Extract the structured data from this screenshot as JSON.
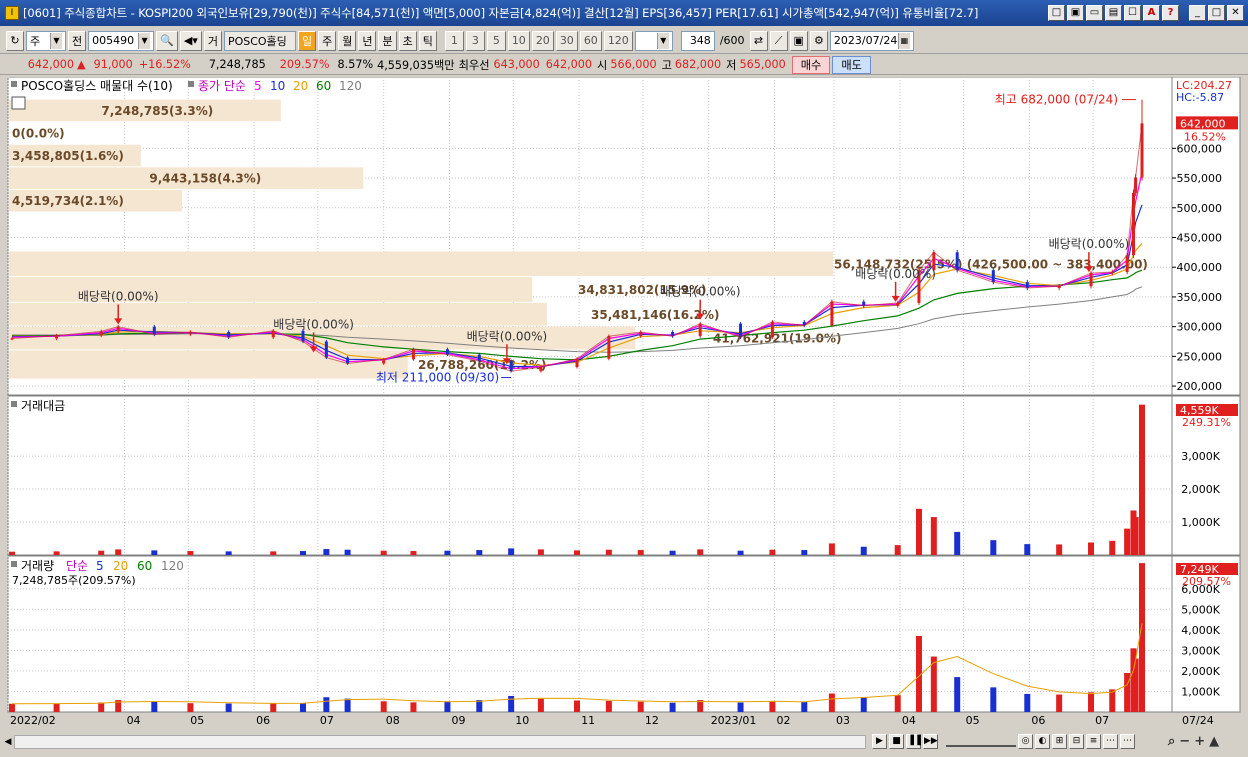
{
  "window": {
    "title": "[0601] 주식종합차트 - KOSPI200 외국인보유[29,790(천)] 주식수[84,571(천)] 액면[5,000] 자본금[4,824(억)] 결산[12월] EPS[36,457] PER[17.61] 시가총액[542,947(억)] 유통비율[72.7]",
    "icon": "app-icon",
    "buttons": [
      "□",
      "▣",
      "▭",
      "▤",
      "☐",
      "A",
      "?",
      "_",
      "□",
      "✕"
    ]
  },
  "toolbar": {
    "type_label": "주",
    "prev_label": "전",
    "code": "005490",
    "name_mode": "거",
    "stock_name": "POSCO홀딩",
    "periods": [
      "일",
      "주",
      "월",
      "년",
      "분",
      "초",
      "틱"
    ],
    "selected_period": "일",
    "intervals": [
      "1",
      "3",
      "5",
      "10",
      "20",
      "30",
      "60",
      "120"
    ],
    "count": "348",
    "count_max": "/600",
    "date": "2023/07/24"
  },
  "quote": {
    "price": "642,000",
    "change": "91,000",
    "change_pct": "+16.52%",
    "volume": "7,248,785",
    "volume_ratio": "209.57%",
    "turnover": "8.57%",
    "amount": "4,559,035백만",
    "best_ask_label": "최우선",
    "best_ask": "643,000",
    "best_bid": "642,000",
    "open_label": "시",
    "open": "566,000",
    "high_label": "고",
    "high": "682,000",
    "low_label": "저",
    "low": "565,000",
    "buy_label": "매수",
    "sell_label": "매도",
    "colors": {
      "up": "#e0201e",
      "down": "#1a2fd0"
    }
  },
  "chart_data": [
    {
      "type": "line",
      "panel": "price",
      "legend": {
        "title": "POSCO홀딩스 매물대 수(10)",
        "ma_label": "종가 단순",
        "ma_periods": [
          "5",
          "10",
          "20",
          "60",
          "120"
        ]
      },
      "x_ticks": [
        "2022/02",
        "04",
        "05",
        "06",
        "07",
        "08",
        "09",
        "10",
        "11",
        "12",
        "2023/01",
        "02",
        "03",
        "04",
        "05",
        "06",
        "07"
      ],
      "x_axis_end_label": "07/24",
      "y_ticks": [
        200000,
        250000,
        300000,
        350000,
        400000,
        450000,
        500000,
        550000,
        600000
      ],
      "y_tick_labels": [
        "200,000",
        "250,000",
        "300,000",
        "350,000",
        "400,000",
        "450,000",
        "500,000",
        "550,000",
        "600,000"
      ],
      "ylim": [
        185000,
        720000
      ],
      "overlay_labels": [
        "LC:204.27",
        "HC:-5.87"
      ],
      "last_value": "642,000",
      "last_pct": "16.52%",
      "volume_profile": [
        {
          "label": "7,248,785(3.3%)",
          "low": 644000,
          "high": 682000,
          "share": 0.33
        },
        {
          "label": "0(0.0%)",
          "low": 606000,
          "high": 644000,
          "share": 0.0
        },
        {
          "label": "3,458,805(1.6%)",
          "low": 568000,
          "high": 606000,
          "share": 0.16
        },
        {
          "label": "9,443,158(4.3%)",
          "low": 530000,
          "high": 568000,
          "share": 0.43
        },
        {
          "label": "4,519,734(2.1%)",
          "low": 492000,
          "high": 530000,
          "share": 0.21
        },
        {
          "label": "56,148,732(25.5%) (426,500.00 ~ 383,400.00)",
          "low": 383400,
          "high": 426500,
          "share": 1.0
        },
        {
          "label": "34,831,802(15.9%)",
          "low": 340000,
          "high": 383400,
          "share": 0.635
        },
        {
          "label": "35,481,146(16.2%)",
          "low": 300000,
          "high": 340000,
          "share": 0.653
        },
        {
          "label": "41,762,921(19.0%)",
          "low": 260000,
          "high": 300000,
          "share": 0.76
        },
        {
          "label": "26,788,260(12.2%)",
          "low": 211000,
          "high": 260000,
          "share": 0.484
        }
      ],
      "annotations": [
        {
          "label": "배당락(0.00%)",
          "date": "2022/03/29",
          "price": 297000
        },
        {
          "label": "배당락(0.00%)",
          "date": "2022/06/29",
          "price": 250000
        },
        {
          "label": "배당락(0.00%)",
          "date": "2022/09/28",
          "price": 230000
        },
        {
          "label": "배당락(0.00%)",
          "date": "2022/12/28",
          "price": 305000
        },
        {
          "label": "배당락(0.00%)",
          "date": "2023/03/30",
          "price": 335000
        },
        {
          "label": "배당락(0.00%)",
          "date": "2023/06/29",
          "price": 385000
        }
      ],
      "high_label": "최고 682,000 (07/24)",
      "low_label": "최저 211,000 (09/30)",
      "series": [
        {
          "name": "종가",
          "x": [
            "2022/02/07",
            "2022/02/28",
            "2022/03/21",
            "2022/03/29",
            "2022/04/15",
            "2022/05/02",
            "2022/05/20",
            "2022/06/10",
            "2022/06/24",
            "2022/07/05",
            "2022/07/15",
            "2022/08/01",
            "2022/08/15",
            "2022/08/31",
            "2022/09/15",
            "2022/09/30",
            "2022/10/14",
            "2022/10/31",
            "2022/11/15",
            "2022/11/30",
            "2022/12/15",
            "2022/12/28",
            "2023/01/16",
            "2023/01/31",
            "2023/02/15",
            "2023/02/28",
            "2023/03/15",
            "2023/03/31",
            "2023/04/10",
            "2023/04/17",
            "2023/04/28",
            "2023/05/15",
            "2023/05/31",
            "2023/06/15",
            "2023/06/30",
            "2023/07/10",
            "2023/07/17",
            "2023/07/20",
            "2023/07/21",
            "2023/07/24"
          ],
          "values": [
            280000,
            285000,
            292000,
            300000,
            287000,
            291000,
            282000,
            293000,
            275000,
            248000,
            238000,
            245000,
            262000,
            253000,
            242000,
            225000,
            232000,
            246000,
            284000,
            291000,
            284000,
            305000,
            282000,
            308000,
            302000,
            342000,
            335000,
            340000,
            395000,
            425000,
            395000,
            375000,
            365000,
            368000,
            390000,
            392000,
            420000,
            525000,
            551000,
            642000
          ]
        },
        {
          "name": "5",
          "values": [
            282000,
            284000,
            290000,
            297000,
            289000,
            290000,
            284000,
            291000,
            278000,
            253000,
            241000,
            244000,
            259000,
            255000,
            244000,
            229000,
            233000,
            244000,
            280000,
            289000,
            285000,
            302000,
            285000,
            305000,
            303000,
            338000,
            336000,
            338000,
            385000,
            415000,
            398000,
            378000,
            367000,
            368000,
            387000,
            391000,
            412000,
            490000,
            510000,
            560000
          ]
        },
        {
          "name": "10",
          "values": [
            283000,
            284000,
            288000,
            294000,
            291000,
            290000,
            286000,
            289000,
            281000,
            260000,
            245000,
            244000,
            255000,
            256000,
            247000,
            233000,
            233000,
            242000,
            274000,
            287000,
            286000,
            298000,
            288000,
            302000,
            303000,
            332000,
            336000,
            337000,
            372000,
            405000,
            400000,
            382000,
            369000,
            368000,
            383000,
            390000,
            404000,
            455000,
            475000,
            505000
          ]
        },
        {
          "name": "20",
          "values": [
            284000,
            284000,
            287000,
            291000,
            292000,
            290000,
            288000,
            288000,
            284000,
            268000,
            252000,
            246000,
            251000,
            255000,
            250000,
            239000,
            235000,
            240000,
            264000,
            283000,
            286000,
            293000,
            290000,
            298000,
            302000,
            322000,
            332000,
            336000,
            358000,
            388000,
            397000,
            386000,
            373000,
            369000,
            378000,
            387000,
            397000,
            420000,
            428000,
            440000
          ]
        },
        {
          "name": "60",
          "values": [
            285000,
            285000,
            286000,
            288000,
            289000,
            289000,
            288000,
            288000,
            287000,
            281000,
            273000,
            266000,
            262000,
            258000,
            255000,
            250000,
            246000,
            244000,
            250000,
            260000,
            268000,
            279000,
            285000,
            290000,
            294000,
            301000,
            310000,
            318000,
            331000,
            345000,
            356000,
            364000,
            368000,
            370000,
            374000,
            379000,
            382000,
            388000,
            391000,
            395000
          ]
        },
        {
          "name": "120",
          "values": [
            286000,
            286000,
            286000,
            287000,
            287000,
            288000,
            288000,
            288000,
            287000,
            285000,
            282000,
            279000,
            276000,
            272000,
            268000,
            264000,
            261000,
            258000,
            257000,
            258000,
            260000,
            264000,
            268000,
            273000,
            278000,
            284000,
            290000,
            297000,
            305000,
            313000,
            320000,
            327000,
            333000,
            338000,
            344000,
            350000,
            354000,
            360000,
            363000,
            367000
          ]
        }
      ]
    },
    {
      "type": "bar",
      "panel": "trading_value",
      "title": "거래대금",
      "y_tick_labels": [
        "1,000K",
        "2,000K",
        "3,000K"
      ],
      "y_ticks": [
        1000,
        2000,
        3000
      ],
      "ylim": [
        0,
        4700
      ],
      "last_value": "4,559K",
      "last_pct": "249.31%",
      "series": [
        {
          "name": "거래대금",
          "values": [
            100,
            110,
            130,
            170,
            140,
            120,
            110,
            110,
            120,
            180,
            160,
            130,
            120,
            130,
            150,
            200,
            170,
            140,
            160,
            150,
            130,
            170,
            130,
            160,
            150,
            350,
            250,
            300,
            1400,
            1150,
            700,
            450,
            330,
            320,
            380,
            430,
            800,
            1350,
            1150,
            4559
          ]
        }
      ]
    },
    {
      "type": "bar",
      "panel": "volume",
      "legend": {
        "title": "거래량",
        "ma_label": "단순",
        "ma_periods": [
          "5",
          "20",
          "60",
          "120"
        ]
      },
      "value_label": "7,248,785주(209.57%)",
      "y_tick_labels": [
        "1,000K",
        "2,000K",
        "3,000K",
        "4,000K",
        "5,000K",
        "6,000K"
      ],
      "y_ticks": [
        1000,
        2000,
        3000,
        4000,
        5000,
        6000
      ],
      "ylim": [
        0,
        7400
      ],
      "last_value": "7,249K",
      "last_pct": "209.57%",
      "series": [
        {
          "name": "거래량",
          "values": [
            400,
            420,
            460,
            580,
            500,
            430,
            410,
            420,
            440,
            720,
            650,
            520,
            470,
            520,
            580,
            780,
            640,
            560,
            540,
            500,
            450,
            580,
            460,
            520,
            500,
            900,
            720,
            820,
            3700,
            2700,
            1700,
            1200,
            880,
            850,
            960,
            1100,
            1900,
            3100,
            2600,
            7249
          ]
        }
      ]
    }
  ],
  "scrollbar": {
    "controls": [
      "▶",
      "■",
      "▐▐",
      "▶▶"
    ],
    "zoom": [
      "−",
      "+",
      "▲"
    ]
  }
}
